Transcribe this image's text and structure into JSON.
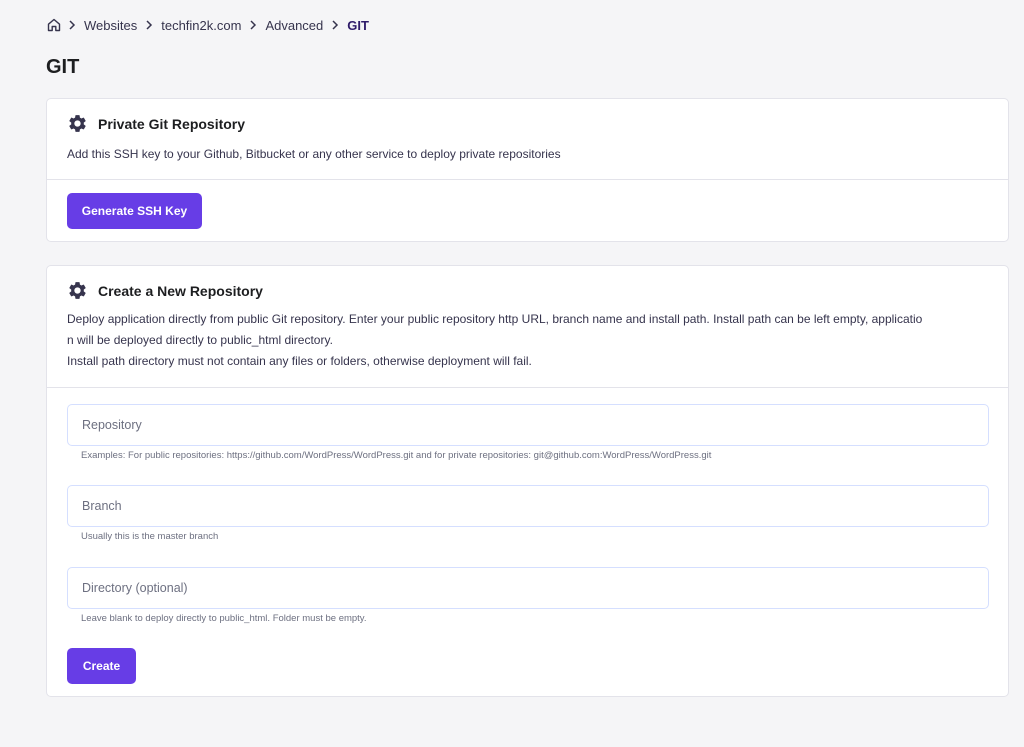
{
  "breadcrumb": {
    "home_icon": "home-icon",
    "items": [
      "Websites",
      "techfin2k.com",
      "Advanced",
      "GIT"
    ]
  },
  "page_title": "GIT",
  "private_repo": {
    "title": "Private Git Repository",
    "description": "Add this SSH key to your Github, Bitbucket or any other service to deploy private repositories",
    "button_label": "Generate SSH Key"
  },
  "new_repo": {
    "title": "Create a New Repository",
    "description_line1": "Deploy application directly from public Git repository. Enter your public repository http URL, branch name and install path. Install path can be left empty, applicatio",
    "description_line2": "n will be deployed directly to public_html directory.",
    "description_line3": "Install path directory must not contain any files or folders, otherwise deployment will fail.",
    "repository": {
      "placeholder": "Repository",
      "hint": "Examples: For public repositories: https://github.com/WordPress/WordPress.git and for private repositories: git@github.com:WordPress/WordPress.git"
    },
    "branch": {
      "placeholder": "Branch",
      "hint": "Usually this is the master branch"
    },
    "directory": {
      "placeholder": "Directory (optional)",
      "hint": "Leave blank to deploy directly to public_html. Folder must be empty."
    },
    "button_label": "Create"
  },
  "colors": {
    "accent": "#673de6",
    "text_dark": "#1d1e20",
    "text_muted": "#6d7081",
    "border": "#e3e3ea",
    "page_bg": "#f5f5f7"
  }
}
